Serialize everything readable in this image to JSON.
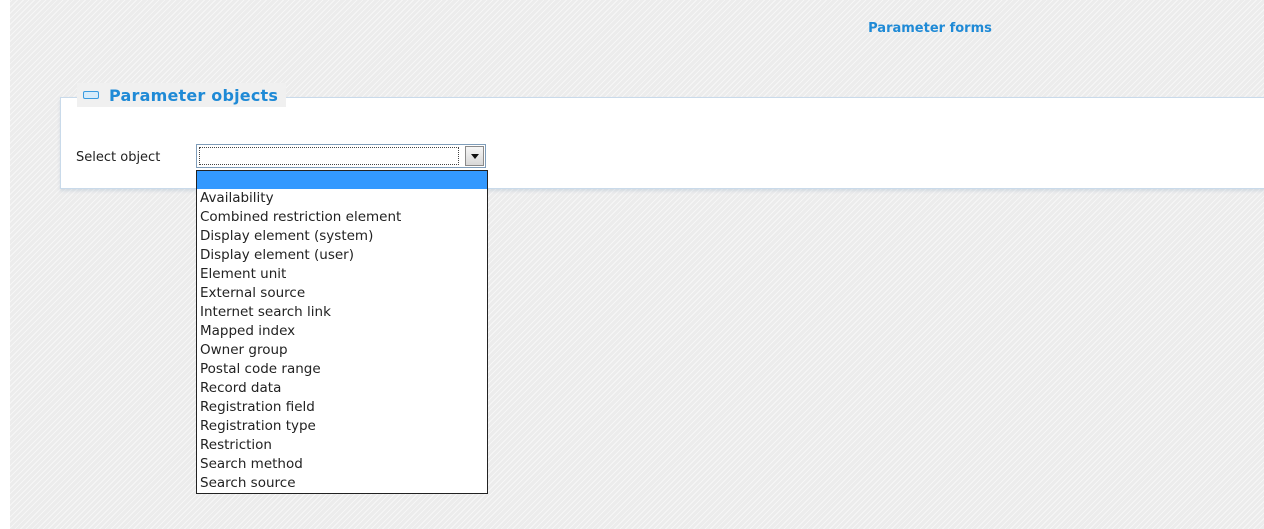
{
  "header": {
    "title": "Parameter forms"
  },
  "section": {
    "title": "Parameter objects"
  },
  "form": {
    "select_label": "Select object",
    "select_value": "",
    "options": [
      "",
      "Availability",
      "Combined restriction element",
      "Display element (system)",
      "Display element (user)",
      "Element unit",
      "External source",
      "Internet search link",
      "Mapped index",
      "Owner group",
      "Postal code range",
      "Record data",
      "Registration field",
      "Registration type",
      "Restriction",
      "Search method",
      "Search source"
    ],
    "highlighted_index": 0
  },
  "icons": {
    "collapse": "collapse-minus-icon",
    "dropdown": "chevron-down-icon"
  },
  "colors": {
    "accent": "#1f8ad6",
    "highlight": "#3399ff",
    "panel_border": "#c9daea"
  }
}
